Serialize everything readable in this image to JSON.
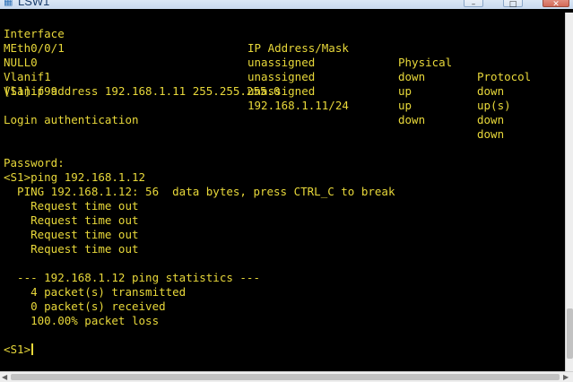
{
  "window": {
    "title": "LSW1",
    "app_icon": "terminal-app-icon",
    "min_glyph": "–",
    "max_glyph": "□",
    "close_glyph": "✕"
  },
  "terminal": {
    "table": {
      "headers": [
        "Interface",
        "IP Address/Mask",
        "Physical",
        "Protocol"
      ],
      "rows": [
        [
          "MEth0/0/1",
          "unassigned",
          "down",
          "down"
        ],
        [
          "NULL0",
          "unassigned",
          "up",
          "up(s)"
        ],
        [
          "Vlanif1",
          "unassigned",
          "up",
          "down"
        ],
        [
          "Vlanif99",
          "192.168.1.11/24",
          "down",
          "down"
        ]
      ]
    },
    "lines": [
      "[S1]ip address 192.168.1.11 255.255.255.0",
      "",
      "Login authentication",
      "",
      "",
      "Password:",
      "<S1>ping 192.168.1.12",
      "  PING 192.168.1.12: 56  data bytes, press CTRL_C to break",
      "    Request time out",
      "    Request time out",
      "    Request time out",
      "    Request time out",
      "",
      "  --- 192.168.1.12 ping statistics ---",
      "    4 packet(s) transmitted",
      "    0 packet(s) received",
      "    100.00% packet loss",
      "",
      "<S1>"
    ],
    "text_color": "#e8d83a",
    "background_color": "#000000"
  }
}
